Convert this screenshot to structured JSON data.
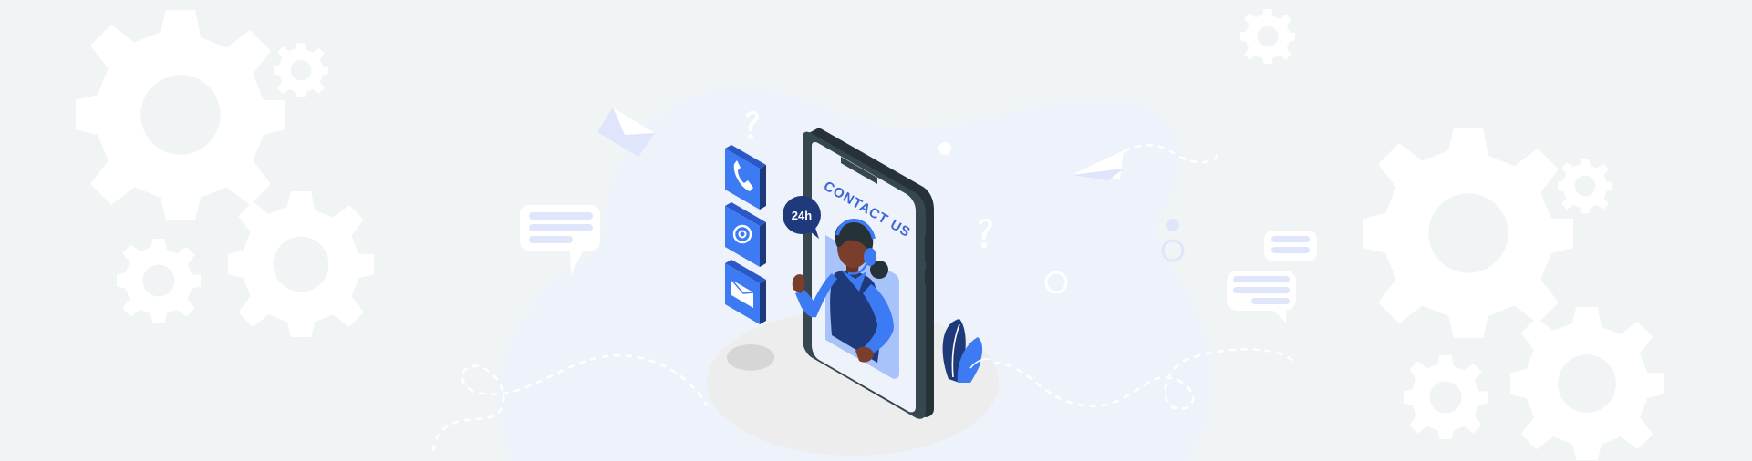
{
  "illustration": {
    "heading": "CONTACT US",
    "badge": "24h"
  },
  "icons": {
    "tile_1": "phone-icon",
    "tile_2": "at-sign-icon",
    "tile_3": "envelope-icon",
    "decor": [
      "gear-icon",
      "paper-plane-icon",
      "chat-bubble-icon",
      "question-mark-icon",
      "headset-icon",
      "plant-icon"
    ]
  },
  "colors": {
    "background": "#f1f4f5",
    "blob": "#eef2fb",
    "accent_blue": "#3d7bf5",
    "dark_navy": "#1f3a7a",
    "phone_frame": "#37474f",
    "gear": "#ffffff"
  }
}
